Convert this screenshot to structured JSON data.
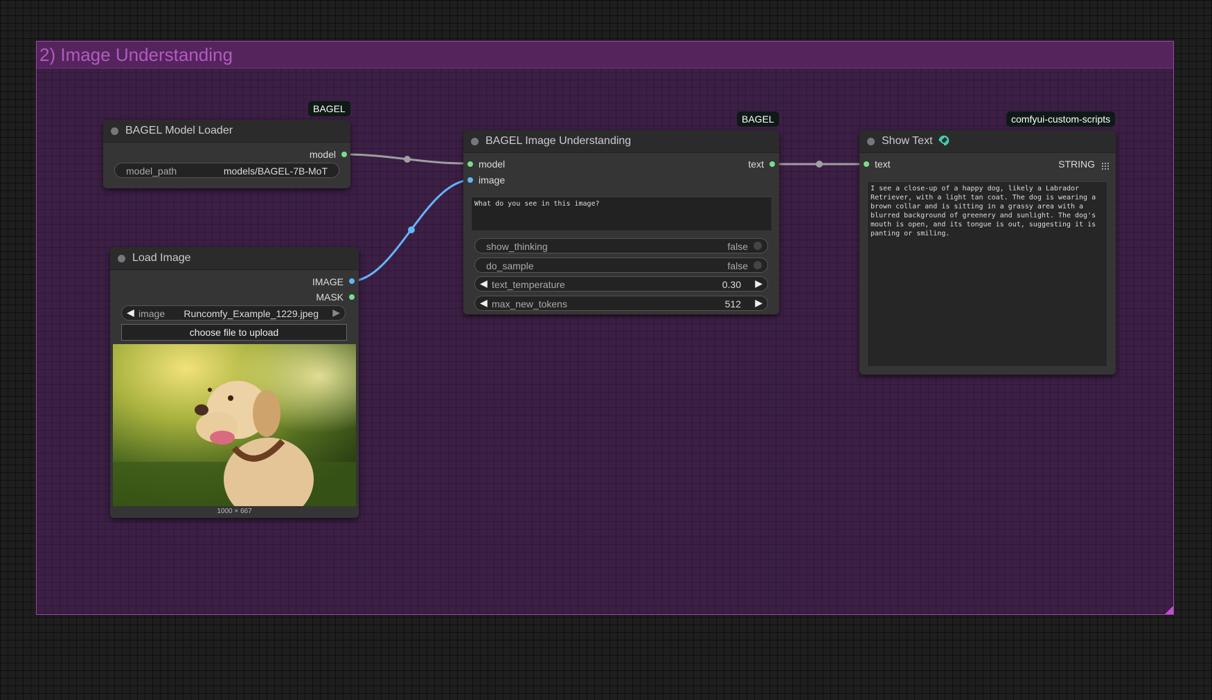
{
  "group": {
    "title": "2) Image Understanding"
  },
  "nodes": {
    "model_loader": {
      "badge": "BAGEL",
      "title": "BAGEL Model Loader",
      "output_model": "model",
      "widget_label": "model_path",
      "widget_value": "models/BAGEL-7B-MoT"
    },
    "load_image": {
      "title": "Load Image",
      "output_image": "IMAGE",
      "output_mask": "MASK",
      "combo_label": "image",
      "combo_value": "Runcomfy_Example_1229.jpeg",
      "upload_label": "choose file to upload",
      "image_size": "1000 × 667"
    },
    "understanding": {
      "badge": "BAGEL",
      "title": "BAGEL Image Understanding",
      "input_model": "model",
      "input_image": "image",
      "output_text": "text",
      "prompt": "What do you see in this image?",
      "widgets": [
        {
          "label": "show_thinking",
          "value": "false"
        },
        {
          "label": "do_sample",
          "value": "false"
        },
        {
          "label": "text_temperature",
          "value": "0.30"
        },
        {
          "label": "max_new_tokens",
          "value": "512"
        }
      ]
    },
    "show_text": {
      "badge": "comfyui-custom-scripts",
      "title": "Show Text",
      "input_text": "text",
      "output_type": "STRING",
      "content": "I see a close-up of a happy dog, likely a Labrador Retriever, with a light tan coat. The dog is wearing a brown collar and is sitting in a grassy area with a blurred background of greenery and sunlight. The dog's mouth is open, and its tongue is out, suggesting it is panting or smiling."
    }
  },
  "colors": {
    "group_bg": "#3c1f45",
    "group_header": "#55245d",
    "group_title": "#b35ac0",
    "link_model": "#b0b0b0",
    "link_image": "#64b5f6",
    "slot_green": "#7bdc8a",
    "slot_blue": "#64b5f6"
  },
  "icons": {
    "show_text_status": "refresh-icon",
    "output_grid": "grid-icon"
  }
}
